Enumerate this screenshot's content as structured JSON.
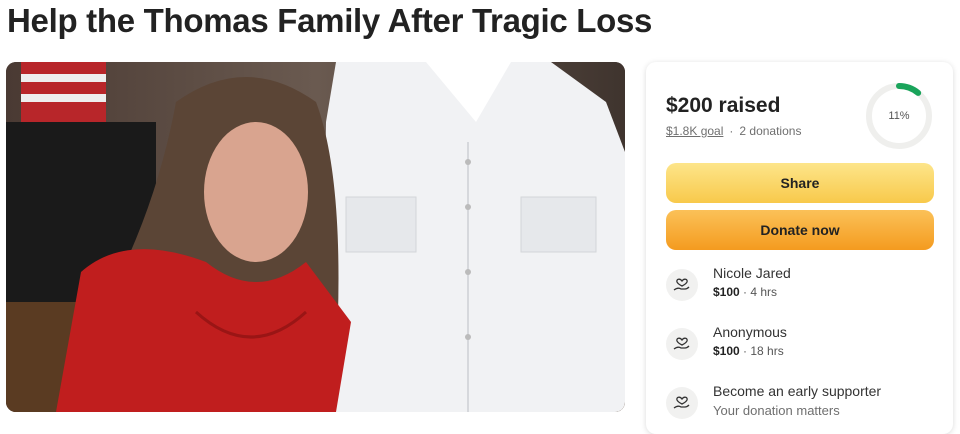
{
  "page": {
    "title": "Help the Thomas Family After Tragic Loss"
  },
  "campaign": {
    "raised": "$200 raised",
    "goal": "$1.8K goal",
    "separator": "·",
    "donations": "2 donations",
    "progress_label": "11%",
    "progress_fraction": 0.11,
    "progress_color": "#1aa45b",
    "share_label": "Share",
    "donate_label": "Donate now"
  },
  "donors": [
    {
      "name": "Nicole Jared",
      "amount": "$100",
      "time": "· 4 hrs",
      "icon": "donation-heart-hand-icon"
    },
    {
      "name": "Anonymous",
      "amount": "$100",
      "time": "· 18 hrs",
      "icon": "donation-heart-hand-icon"
    }
  ],
  "supporter": {
    "title": "Become an early supporter",
    "subtitle": "Your donation matters",
    "icon": "donation-heart-hand-icon"
  }
}
